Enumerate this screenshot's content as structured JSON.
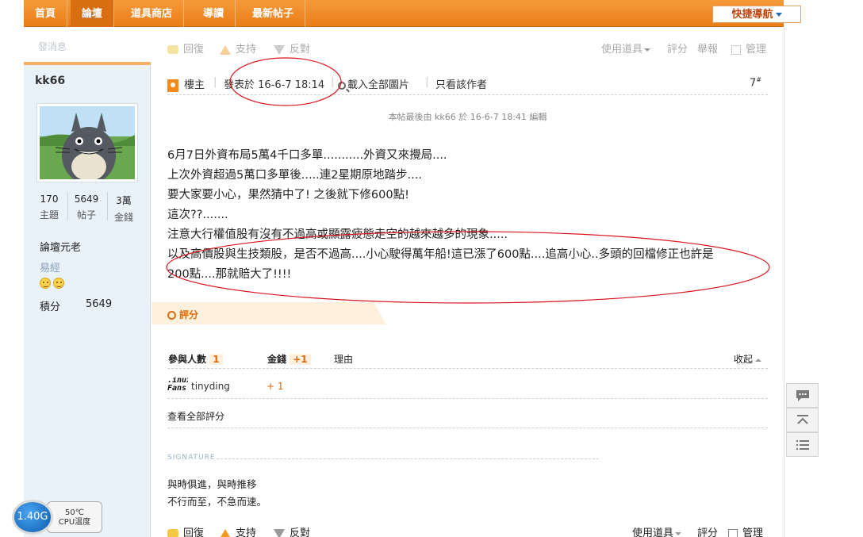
{
  "nav": {
    "items": [
      "首頁",
      "論壇",
      "道具商店",
      "導讀",
      "最新帖子"
    ],
    "quick_nav": "快捷導航"
  },
  "side": {
    "ghost_text": "發消息",
    "author": "kk66",
    "stats": [
      {
        "value": "170",
        "label": "主題"
      },
      {
        "value": "5649",
        "label": "帖子"
      },
      {
        "value": "3萬",
        "label": "金錢"
      }
    ],
    "rank": "論壇元老",
    "group": "易經",
    "points_label": "積分",
    "points_value": "5649"
  },
  "post": {
    "actions_top": {
      "reply": "回復",
      "support": "支持",
      "oppose": "反對",
      "use_tool": "使用道具",
      "rate": "評分",
      "report": "舉報",
      "manage": "管理"
    },
    "header": {
      "owner": "樓主",
      "posted": "發表於 16-6-7 18:14",
      "load_images": "載入全部圖片",
      "author_only": "只看該作者",
      "floor": "7",
      "floor_sup": "#"
    },
    "edit_note": "本帖最後由 kk66 於 16-6-7 18:41 編輯",
    "body": [
      "6月7日外資布局5萬4千口多單...........外資又來攪局....",
      "上次外資超過5萬口多單後.....連2星期原地踏步....",
      "要大家要小心，果然猜中了! 之後就下修600點!",
      "這次??.......",
      "注意大行權值股有沒有不過高或顯露疲態走空的越來越多的現象.....",
      "以及高價股與生技類股，是否不過高....小心駛得萬年船!這已漲了600點....追高小心..多頭的回檔修正也許是",
      "200點....那就賠大了!!!!"
    ],
    "rating": {
      "title": "評分",
      "participants_label": "參與人數",
      "participants_count": "1",
      "money_label": "金錢",
      "money_total": "+1",
      "reason_label": "理由",
      "collapse": "收起",
      "rater_logo": ".inux\nFans",
      "rater": "tinyding",
      "rater_money": "+ 1",
      "view_all": "查看全部評分"
    },
    "signature": {
      "label": "SIGNATURE",
      "line1": "與時俱進，與時推移",
      "line2": "不行而至，不急而速。"
    },
    "actions_bottom": {
      "reply": "回復",
      "support": "支持",
      "oppose": "反對",
      "use_tool": "使用道具",
      "rate": "評分",
      "manage": "管理"
    }
  },
  "widget": {
    "cpu": "1.40G",
    "temp": "50℃",
    "temp_label": "CPU温度"
  },
  "colors": {
    "nav_orange": "#ea7d17",
    "side_bg": "#e9f1f9",
    "accent": "#e06a10",
    "annotation_red": "#d9141e"
  }
}
